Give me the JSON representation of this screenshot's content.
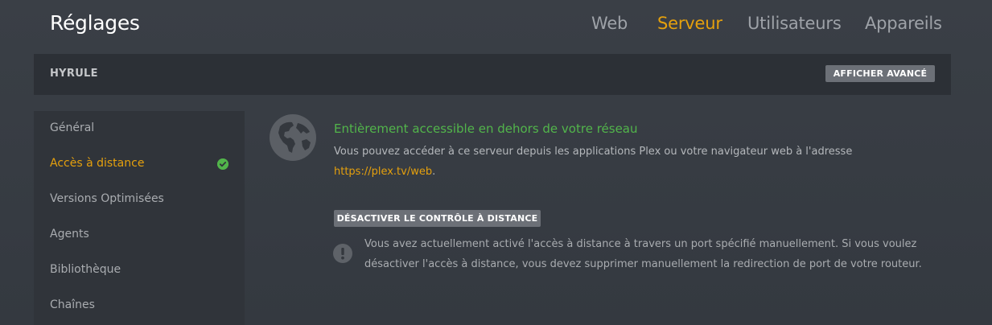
{
  "header": {
    "title": "Réglages",
    "tabs": [
      {
        "label": "Web"
      },
      {
        "label": "Serveur",
        "active": true
      },
      {
        "label": "Utilisateurs"
      },
      {
        "label": "Appareils"
      }
    ]
  },
  "server_bar": {
    "name": "HYRULE",
    "advanced_button": "AFFICHER AVANCÉ"
  },
  "sidebar": {
    "items": [
      {
        "label": "Général"
      },
      {
        "label": "Accès à distance",
        "active": true,
        "status_icon": "check-circle-icon"
      },
      {
        "label": "Versions Optimisées"
      },
      {
        "label": "Agents"
      },
      {
        "label": "Bibliothèque"
      },
      {
        "label": "Chaînes"
      }
    ]
  },
  "remote": {
    "status_icon": "globe-icon",
    "status_title": "Entièrement accessible en dehors de votre réseau",
    "description": "Vous pouvez accéder à ce serveur depuis les applications Plex ou votre navigateur web à l'adresse",
    "link": "https://plex.tv/web",
    "link_suffix": ".",
    "disable_button": "DÉSACTIVER LE CONTRÔLE À DISTANCE",
    "warning_icon": "exclamation-icon",
    "warning_text": "Vous avez actuellement activé l'accès à distance à travers un port spécifié manuellement. Si vous voulez désactiver l'accès à distance, vous devez supprimer manuellement la redirection de port de votre routeur."
  },
  "colors": {
    "accent": "#e5a00d",
    "success": "#52b54b",
    "background": "#3a3f46",
    "panel": "#2c3036"
  }
}
